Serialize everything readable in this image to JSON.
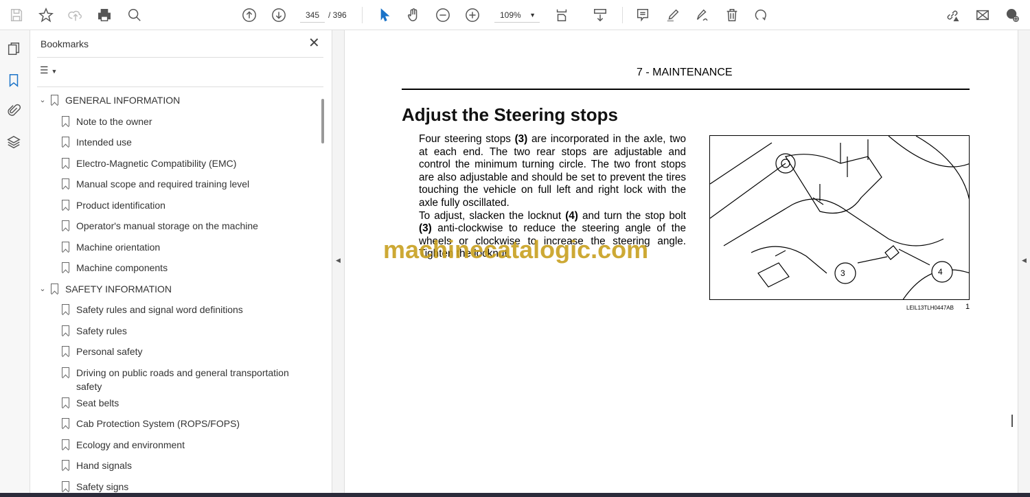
{
  "toolbar": {
    "page_current": "345",
    "page_total": "/ 396",
    "zoom": "109%"
  },
  "panel": {
    "title": "Bookmarks"
  },
  "bookmarks": [
    {
      "label": "GENERAL INFORMATION",
      "level": 0
    },
    {
      "label": "Note to the owner",
      "level": 1
    },
    {
      "label": "Intended use",
      "level": 1
    },
    {
      "label": "Electro-Magnetic Compatibility (EMC)",
      "level": 1
    },
    {
      "label": "Manual scope and required training level",
      "level": 1
    },
    {
      "label": "Product identification",
      "level": 1
    },
    {
      "label": "Operator's manual storage on the machine",
      "level": 1
    },
    {
      "label": "Machine orientation",
      "level": 1
    },
    {
      "label": "Machine components",
      "level": 1
    },
    {
      "label": "SAFETY INFORMATION",
      "level": 0
    },
    {
      "label": "Safety rules and signal word definitions",
      "level": 1
    },
    {
      "label": "Safety rules",
      "level": 1
    },
    {
      "label": "Personal safety",
      "level": 1
    },
    {
      "label": "Driving on public roads and general transportation safety",
      "level": 1
    },
    {
      "label": "Seat belts",
      "level": 1
    },
    {
      "label": "Cab Protection System (ROPS/FOPS)",
      "level": 1
    },
    {
      "label": "Ecology and environment",
      "level": 1
    },
    {
      "label": "Hand signals",
      "level": 1
    },
    {
      "label": "Safety signs",
      "level": 1
    }
  ],
  "document": {
    "section_header": "7 - MAINTENANCE",
    "title": "Adjust the Steering stops",
    "para1": [
      "Four steering stops ",
      "(3)",
      " are incorporated in the axle, two at each end.  The two rear stops are adjustable and control the minimum turning circle. The two front stops are also adjustable and should be set to prevent the tires touching the vehicle on full left and right lock with the axle fully oscillated."
    ],
    "para2": [
      "To adjust, slacken the locknut ",
      "(4)",
      " and turn the stop bolt ",
      "(3)",
      " anti-clockwise to reduce the steering angle of the wheels or clockwise to increase the steering angle. Tighten the locknut."
    ],
    "figure": {
      "callout_3": "3",
      "callout_4": "4",
      "caption": "LEIL13TLH0447AB",
      "number": "1"
    },
    "watermark": "machinecatalogic.com"
  }
}
